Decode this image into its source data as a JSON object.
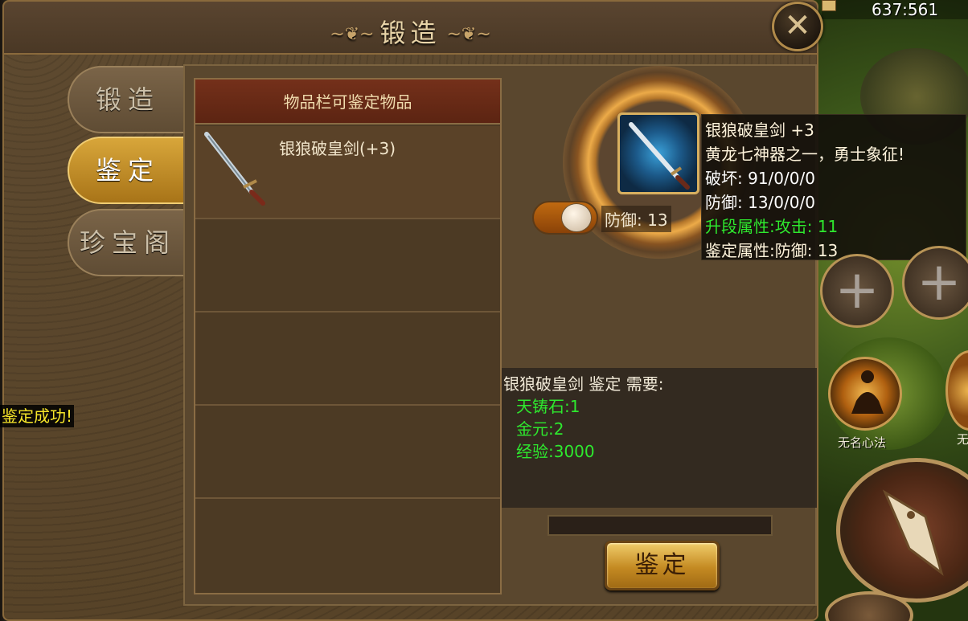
{
  "hud": {
    "coords": "637:561"
  },
  "window": {
    "title": "锻造",
    "close_label": "✕"
  },
  "tabs": [
    {
      "label": "锻造",
      "active": false
    },
    {
      "label": "鉴定",
      "active": true
    },
    {
      "label": "珍宝阁",
      "active": false
    }
  ],
  "list": {
    "header": "物品栏可鉴定物品",
    "items": [
      {
        "name": "银狼破皇剑(+3)",
        "icon": "sword-icon"
      }
    ]
  },
  "detail": {
    "toggle_label": "防御: 13",
    "tooltip": {
      "name": "银狼破皇剑 +3",
      "desc": "黄龙七神器之一，勇士象征!",
      "attack": "破坏: 91/0/0/0",
      "defense": "防御: 13/0/0/0",
      "upgrade_attr": "升段属性:攻击: 11",
      "identify_attr": "鉴定属性:防御: 13"
    },
    "requirements": {
      "title": "银狼破皇剑 鉴定 需要:",
      "items": [
        "天铸石:1",
        "金元:2",
        "经验:3000"
      ]
    },
    "action_label": "鉴定"
  },
  "skills": {
    "skill1_label": "无名心法",
    "skill2_label": "无"
  },
  "toast": "鉴定成功!",
  "colors": {
    "accent_gold": "#d8a63a",
    "requirement_green": "#2ee82e",
    "toast_yellow": "#f7e62a"
  }
}
